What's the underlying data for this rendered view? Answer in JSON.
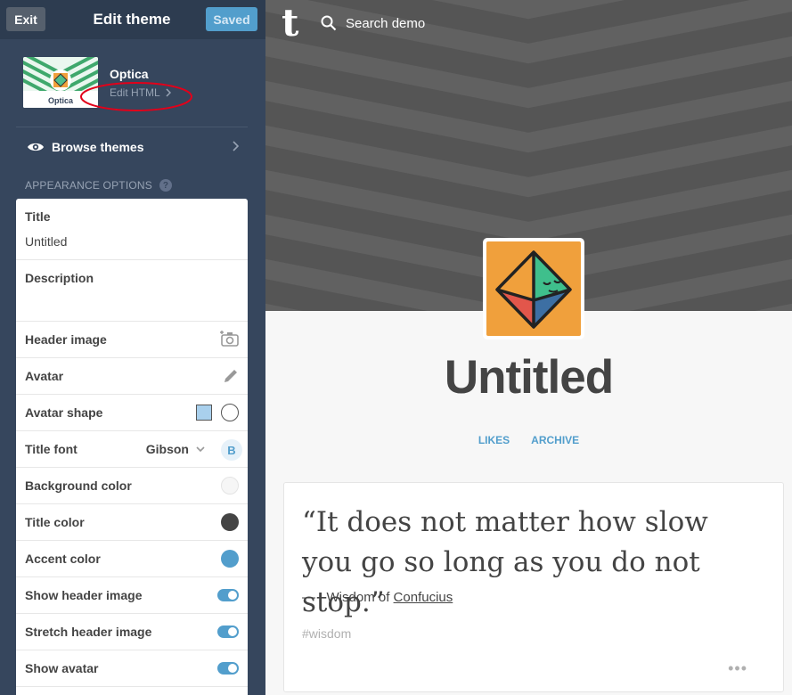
{
  "topbar": {
    "exit_label": "Exit",
    "title": "Edit theme",
    "saved_label": "Saved"
  },
  "theme": {
    "name": "Optica",
    "thumb_label": "Optica",
    "edit_html_label": "Edit HTML"
  },
  "browse_themes": {
    "label": "Browse themes",
    "icon": "eye-icon"
  },
  "appearance": {
    "heading": "APPEARANCE OPTIONS",
    "help_glyph": "?"
  },
  "options": {
    "title": {
      "label": "Title",
      "value": "Untitled"
    },
    "description": {
      "label": "Description",
      "value": ""
    },
    "header_image": {
      "label": "Header image",
      "icon": "camera-icon"
    },
    "avatar": {
      "label": "Avatar",
      "icon": "pencil-icon"
    },
    "avatar_shape": {
      "label": "Avatar shape",
      "selected": "square"
    },
    "title_font": {
      "label": "Title font",
      "value": "Gibson",
      "bold_label": "B"
    },
    "background_color": {
      "label": "Background color",
      "color": "#f6f6f6"
    },
    "title_color": {
      "label": "Title color",
      "color": "#444444"
    },
    "accent_color": {
      "label": "Accent color",
      "color": "#529ecc"
    },
    "show_header_image": {
      "label": "Show header image",
      "on": true
    },
    "stretch_header_image": {
      "label": "Stretch header image",
      "on": true
    },
    "show_avatar": {
      "label": "Show avatar",
      "on": true
    }
  },
  "preview": {
    "logo": "t",
    "search_placeholder": "Search demo",
    "blog_title": "Untitled",
    "nav": [
      "LIKES",
      "ARCHIVE"
    ],
    "post": {
      "quote": "“It does not matter how slow you go so long as you do not stop.”",
      "source_dash": "—",
      "source_prefix": "Wisdom of",
      "source_link": "Confucius",
      "tag": "#wisdom",
      "more": "•••"
    }
  },
  "colors": {
    "sidebar": "#36465d",
    "accent": "#529ecc",
    "annotation": "#e2001a"
  }
}
